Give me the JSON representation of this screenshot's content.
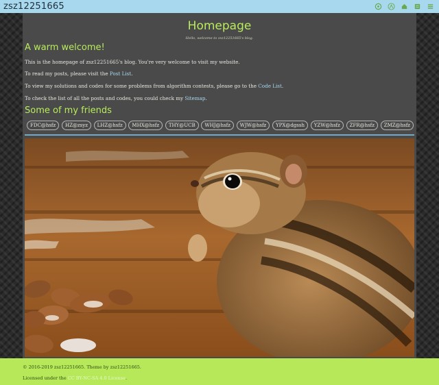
{
  "header": {
    "site_title": "zsz12251665",
    "icons": [
      "github-icon",
      "rss-icon",
      "home-icon",
      "list-icon",
      "menu-icon"
    ]
  },
  "hero": {
    "title": "Homepage",
    "subtitle": "Hello, welcome to zsz12251665's blog."
  },
  "welcome": {
    "heading": "A warm welcome!",
    "p1": "This is the homepage of zsz12251665's blog. You're very welcome to visit my website.",
    "p2_before": "To read my posts, please visit the ",
    "p2_link": "Post List",
    "p2_after": ".",
    "p3_before": "To view my solutions and codes for some problems from algorithm contests, please go to the ",
    "p3_link": "Code List",
    "p3_after": ".",
    "p4_before": "To check the list of all the posts and codes, you could check my ",
    "p4_link": "Sitemap",
    "p4_after": "."
  },
  "friends": {
    "heading": "Some of my friends",
    "items": [
      "FDC@hsfz",
      "HZ@zsyz",
      "LHZ@hsfz",
      "MHX@hsfz",
      "THY@UCB",
      "WHJ@hsfz",
      "WJW@hsfz",
      "YPX@dgssh",
      "YZW@hsfz",
      "ZFR@hsfz",
      "ZMZ@hsfz"
    ]
  },
  "photo": {
    "subject": "chipmunk-with-almonds"
  },
  "footer": {
    "copyright": "© 2016-2019 zsz12251665. Theme by zsz12251665.",
    "license_before": "Licensed under the ",
    "license_link": "CC BY-NC-SA 4.0 License",
    "license_after": "."
  },
  "colors": {
    "accent_green": "#b8ec5a",
    "topbar_blue": "#a8d8ee",
    "panel_gray": "#4a4a4a",
    "footer_green": "#b6e85a"
  }
}
